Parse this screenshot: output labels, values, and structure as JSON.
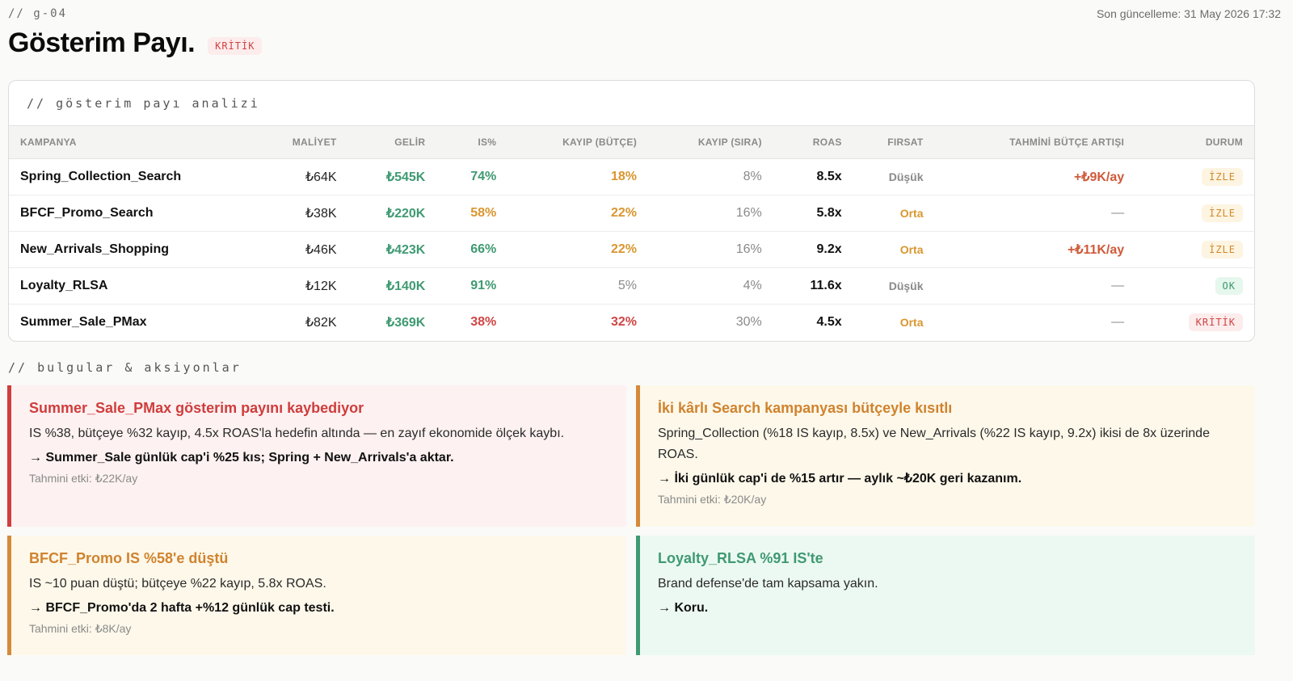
{
  "header": {
    "page_code": "// g-04",
    "last_update": "Son güncelleme: 31 May 2026 17:32",
    "title": "Gösterim Payı.",
    "status_badge": "KRİTİK"
  },
  "table_panel": {
    "caption": "// gösterim payı analizi",
    "columns": [
      "KAMPANYA",
      "MALİYET",
      "GELİR",
      "IS%",
      "KAYIP (BÜTÇE)",
      "KAYIP (SIRA)",
      "ROAS",
      "FIRSAT",
      "TAHMİNİ BÜTÇE ARTIŞI",
      "DURUM"
    ],
    "rows": [
      {
        "campaign": "Spring_Collection_Search",
        "cost": "₺64K",
        "revenue": "₺545K",
        "is": "74%",
        "lost_budget": "18%",
        "lost_rank": "8%",
        "roas": "8.5x",
        "opportunity": "Düşük",
        "budget_increase": "+₺9K/ay",
        "status": "İZLE"
      },
      {
        "campaign": "BFCF_Promo_Search",
        "cost": "₺38K",
        "revenue": "₺220K",
        "is": "58%",
        "lost_budget": "22%",
        "lost_rank": "16%",
        "roas": "5.8x",
        "opportunity": "Orta",
        "budget_increase": "—",
        "status": "İZLE"
      },
      {
        "campaign": "New_Arrivals_Shopping",
        "cost": "₺46K",
        "revenue": "₺423K",
        "is": "66%",
        "lost_budget": "22%",
        "lost_rank": "16%",
        "roas": "9.2x",
        "opportunity": "Orta",
        "budget_increase": "+₺11K/ay",
        "status": "İZLE"
      },
      {
        "campaign": "Loyalty_RLSA",
        "cost": "₺12K",
        "revenue": "₺140K",
        "is": "91%",
        "lost_budget": "5%",
        "lost_rank": "4%",
        "roas": "11.6x",
        "opportunity": "Düşük",
        "budget_increase": "—",
        "status": "OK"
      },
      {
        "campaign": "Summer_Sale_PMax",
        "cost": "₺82K",
        "revenue": "₺369K",
        "is": "38%",
        "lost_budget": "32%",
        "lost_rank": "30%",
        "roas": "4.5x",
        "opportunity": "Orta",
        "budget_increase": "—",
        "status": "KRİTİK"
      }
    ]
  },
  "findings": {
    "caption": "// bulgular & aksiyonlar",
    "cards": [
      {
        "title": "Summer_Sale_PMax gösterim payını kaybediyor",
        "body": "IS %38, bütçeye %32 kayıp, 4.5x ROAS'la hedefin altında — en zayıf ekonomide ölçek kaybı.",
        "action": "→ Summer_Sale günlük cap'i %25 kıs; Spring + New_Arrivals'a aktar.",
        "effect": "Tahmini etki: ₺22K/ay"
      },
      {
        "title": "İki kârlı Search kampanyası bütçeyle kısıtlı",
        "body": "Spring_Collection (%18 IS kayıp, 8.5x) ve New_Arrivals (%22 IS kayıp, 9.2x) ikisi de 8x üzerinde ROAS.",
        "action": "→ İki günlük cap'i de %15 artır — aylık ~₺20K geri kazanım.",
        "effect": "Tahmini etki: ₺20K/ay"
      },
      {
        "title": "BFCF_Promo IS %58'e düştü",
        "body": "IS ~10 puan düştü; bütçeye %22 kayıp, 5.8x ROAS.",
        "action": "→ BFCF_Promo'da 2 hafta +%12 günlük cap testi.",
        "effect": "Tahmini etki: ₺8K/ay"
      },
      {
        "title": "Loyalty_RLSA %91 IS'te",
        "body": "Brand defense'de tam kapsama yakın.",
        "action": "→ Koru."
      }
    ]
  },
  "colors": {
    "critical": "#d04444",
    "watch": "#d08a2a",
    "ok": "#3a9a6a",
    "positive": "#3f9a72"
  }
}
